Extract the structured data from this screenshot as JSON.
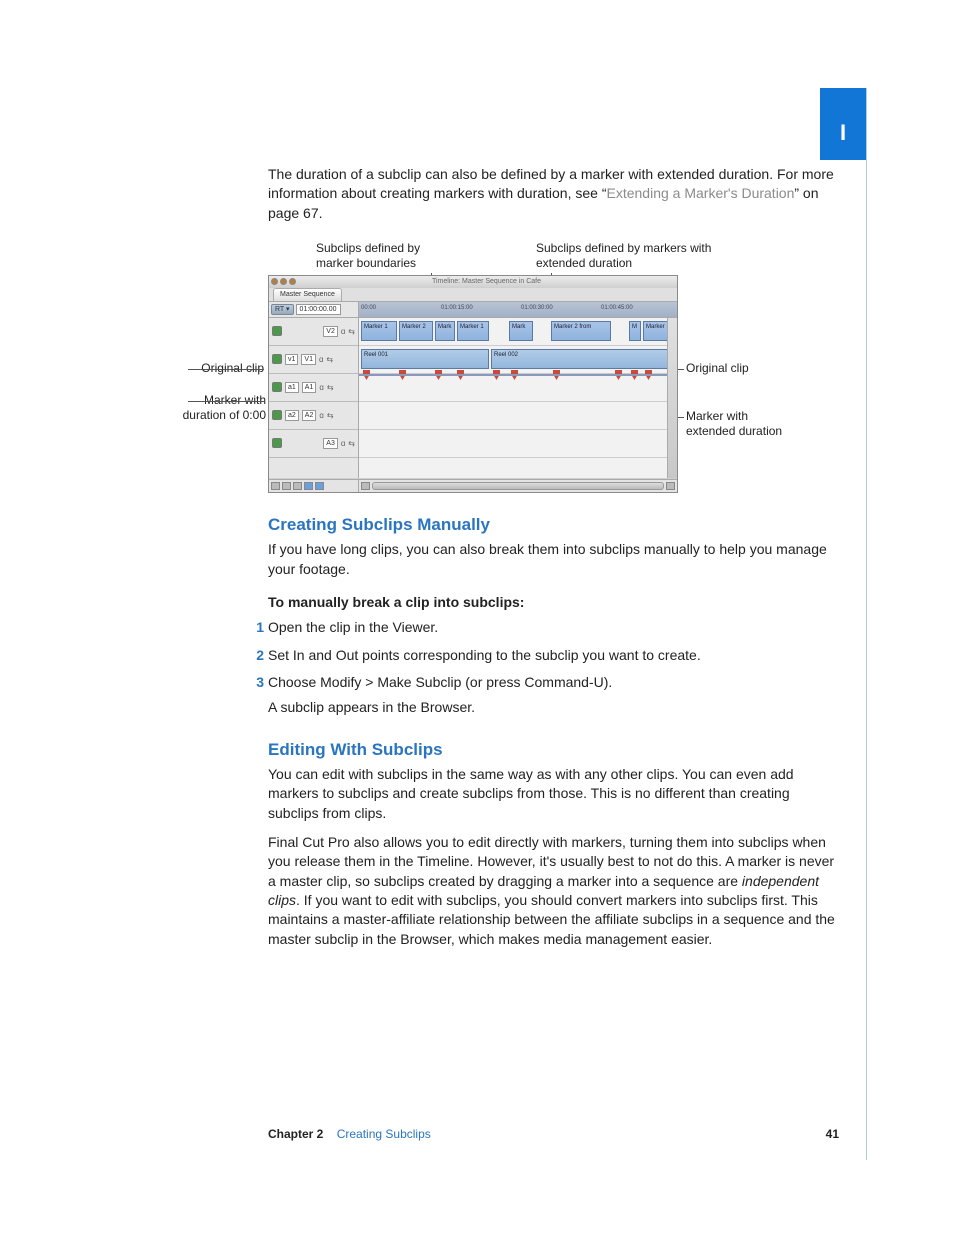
{
  "sidebar_tab": "I",
  "intro": {
    "text_a": "The duration of a subclip can also be defined by a marker with extended duration. For more information about creating markers with duration, see “",
    "link": "Extending a Marker's Duration",
    "text_b": "” on page 67."
  },
  "figure": {
    "callout_top_left": "Subclips defined by marker boundaries",
    "callout_top_right": "Subclips defined by markers with extended duration",
    "callout_left_1": "Original clip",
    "callout_left_2": "Marker with duration of 0:00",
    "callout_right_1": "Original clip",
    "callout_right_2": "Marker with extended duration",
    "timeline": {
      "window_title": "Timeline: Master Sequence in Cafe",
      "tab": "Master Sequence",
      "rt_label": "RT ▾",
      "timecode": "01:00:00.00",
      "ticks": [
        "00:00",
        "01:00:15:00",
        "01:00:30:00",
        "01:00:45:00"
      ],
      "tracks": {
        "v2": {
          "label": "V2",
          "lock": "ɑ",
          "auto": "⇆"
        },
        "v1": {
          "src": "v1",
          "dst": "V1",
          "lock": "ɑ",
          "auto": "⇆"
        },
        "a1": {
          "src": "a1",
          "dst": "A1",
          "lock": "ɑ",
          "auto": "⇆"
        },
        "a2": {
          "src": "a2",
          "dst": "A2",
          "lock": "ɑ",
          "auto": "⇆"
        },
        "a3": {
          "label": "A3",
          "lock": "ɑ",
          "auto": "⇆"
        }
      },
      "v2_clips": [
        "Marker 1",
        "Marker 2",
        "Mark",
        "Marker 1",
        "Mark",
        "Marker 2 from",
        "M",
        "Marker"
      ],
      "v1_clips": [
        "Reel 001",
        "Reel 002"
      ]
    }
  },
  "section1": {
    "heading": "Creating Subclips Manually",
    "para": "If you have long clips, you can also break them into subclips manually to help you manage your footage.",
    "steps_heading": "To manually break a clip into subclips:",
    "steps": [
      "Open the clip in the Viewer.",
      "Set In and Out points corresponding to the subclip you want to create.",
      "Choose Modify > Make Subclip (or press Command-U)."
    ],
    "result": "A subclip appears in the Browser."
  },
  "section2": {
    "heading": "Editing With Subclips",
    "para1": "You can edit with subclips in the same way as with any other clips. You can even add markers to subclips and create subclips from those. This is no different than creating subclips from clips.",
    "para2_a": "Final Cut Pro also allows you to edit directly with markers, turning them into subclips when you release them in the Timeline. However, it's usually best to not do this. A marker is never a master clip, so subclips created by dragging a marker into a sequence are ",
    "para2_em": "independent clips",
    "para2_b": ". If you want to edit with subclips, you should convert markers into subclips first. This maintains a master-affiliate relationship between the affiliate subclips in a sequence and the master subclip in the Browser, which makes media management easier."
  },
  "footer": {
    "chapter_label": "Chapter 2",
    "chapter_title": "Creating Subclips",
    "page": "41"
  }
}
